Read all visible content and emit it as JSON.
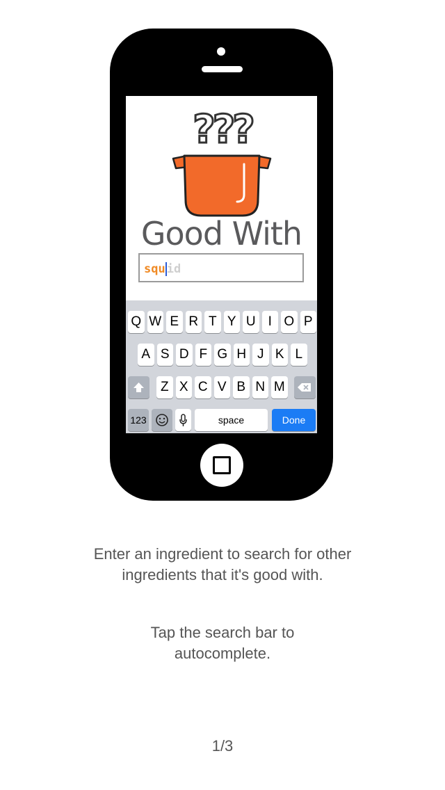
{
  "app": {
    "brand": "Good With",
    "logo_mark": "???"
  },
  "search": {
    "typed": "squ",
    "suggestion": "id"
  },
  "keyboard": {
    "row1": [
      "Q",
      "W",
      "E",
      "R",
      "T",
      "Y",
      "U",
      "I",
      "O",
      "P"
    ],
    "row2": [
      "A",
      "S",
      "D",
      "F",
      "G",
      "H",
      "J",
      "K",
      "L"
    ],
    "row3": [
      "Z",
      "X",
      "C",
      "V",
      "B",
      "N",
      "M"
    ],
    "numbers_label": "123",
    "space_label": "space",
    "done_label": "Done",
    "shift_icon": "shift-arrow-icon",
    "delete_icon": "backspace-icon",
    "emoji_icon": "emoji-icon",
    "mic_icon": "microphone-icon"
  },
  "instructions": {
    "line1": "Enter an ingredient to search for other",
    "line2": "ingredients that it's good with.",
    "line3": "Tap the search bar to",
    "line4": "autocomplete."
  },
  "pager": {
    "indicator": "1/3"
  },
  "colors": {
    "pot_orange": "#f26a2a",
    "typed_orange": "#f08a24",
    "done_blue": "#1b7cf5"
  }
}
